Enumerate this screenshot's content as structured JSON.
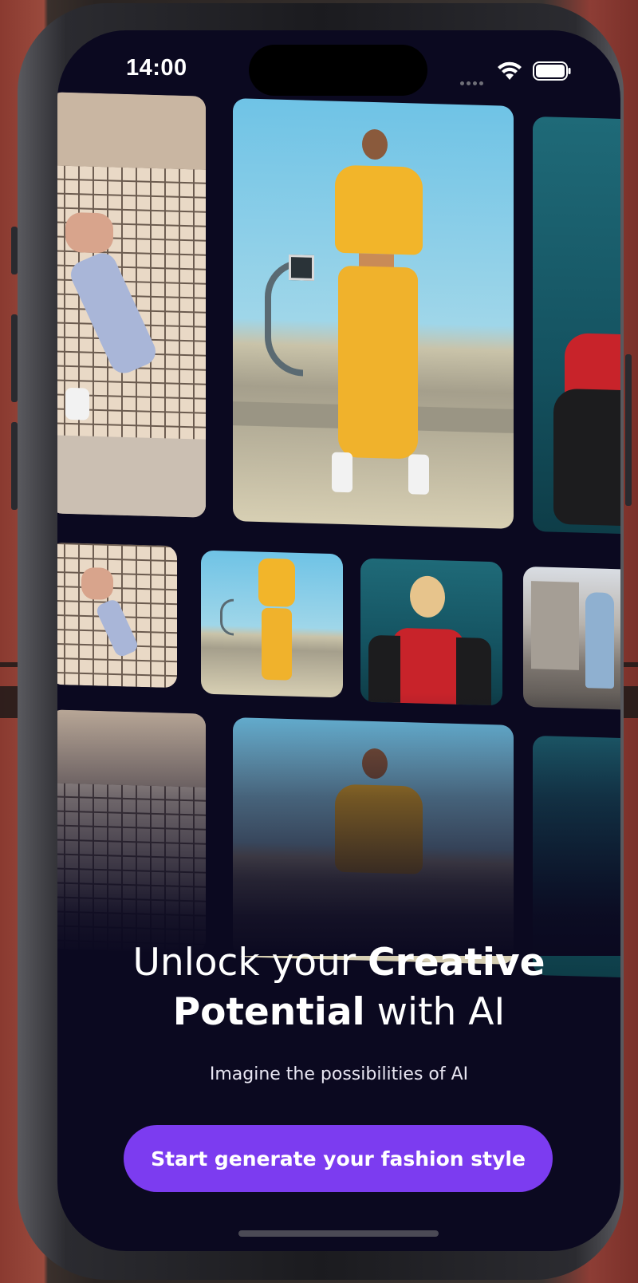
{
  "status_bar": {
    "time": "14:00"
  },
  "hero": {
    "headline_part1": "Unlock your ",
    "headline_bold1": "Creative",
    "headline_bold2": "Potential",
    "headline_part2": " with AI",
    "subtitle": "Imagine the possibilities of AI"
  },
  "cta": {
    "label": "Start generate your fashion style"
  },
  "colors": {
    "background": "#0b0920",
    "accent": "#7c3cf0",
    "text": "#ffffff"
  },
  "icons": [
    "cellular-signal-icon",
    "wifi-icon",
    "battery-icon"
  ]
}
